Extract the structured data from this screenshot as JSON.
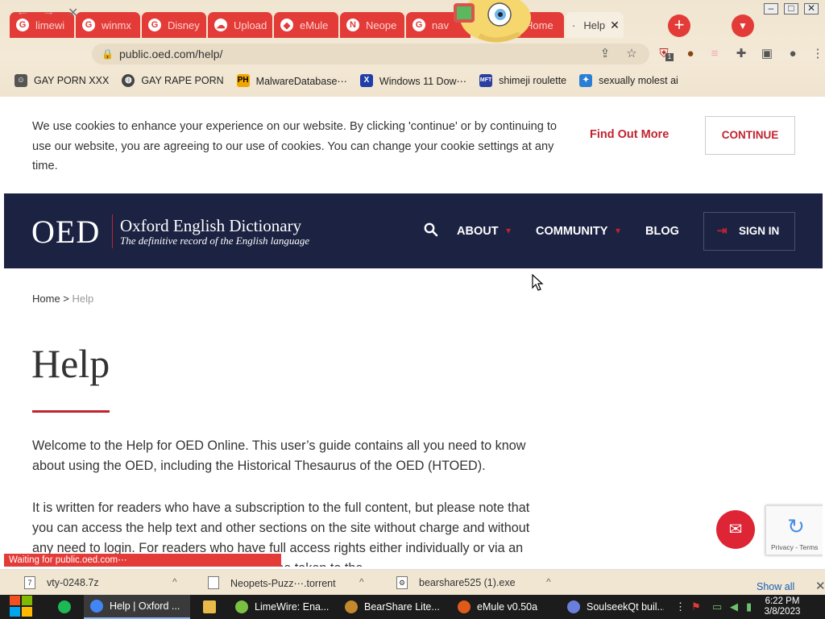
{
  "browser": {
    "tabs": [
      {
        "label": "limewi",
        "favicon": "G"
      },
      {
        "label": "winmx",
        "favicon": "G"
      },
      {
        "label": "Disney",
        "favicon": "G"
      },
      {
        "label": "Upload",
        "favicon": "☁"
      },
      {
        "label": "eMule",
        "favicon": "◆"
      },
      {
        "label": "Neope",
        "favicon": "N"
      },
      {
        "label": "nav",
        "favicon": "G"
      },
      {
        "label": "Home",
        "favicon": "O"
      },
      {
        "label": "Help",
        "favicon": "·"
      }
    ],
    "url": "public.oed.com/help/",
    "bookmarks": [
      {
        "label": "GAY PORN XXX"
      },
      {
        "label": "GAY RAPE PORN"
      },
      {
        "label": "MalwareDatabase⋯"
      },
      {
        "label": "Windows 11 Dow⋯"
      },
      {
        "label": "shimeji roulette"
      },
      {
        "label": "sexually molest ai"
      }
    ],
    "status_text": "Waiting for public.oed.com⋯",
    "extension_badge": "1"
  },
  "cookie_banner": {
    "text": "We use cookies to enhance your experience on our website. By clicking 'continue' or by continuing to use our website, you are agreeing to our use of cookies. You can change your cookie settings at any time.",
    "find_out_more": "Find Out More",
    "continue": "CONTINUE"
  },
  "header": {
    "logo": "OED",
    "name": "Oxford English Dictionary",
    "tagline": "The definitive record of the English language",
    "nav": {
      "about": "ABOUT",
      "community": "COMMUNITY",
      "blog": "BLOG"
    },
    "sign_in": "SIGN IN"
  },
  "breadcrumb": {
    "home": "Home",
    "separator": " > ",
    "current": "Help"
  },
  "main": {
    "title": "Help",
    "para1": "Welcome to the Help for OED Online. This user’s guide contains all you need to know about using the OED, including the Historical Thesaurus of the OED (HTOED).",
    "para2": "It is written for readers who have a subscription to the full content, but please note that you can access the help text and other sections on the site without charge and without any need to login. For readers who have full access rights either individually or via an institution, once you are logged in you will be taken to the"
  },
  "recaptcha": {
    "text": "Privacy - Terms"
  },
  "downloads": {
    "items": [
      {
        "name": "vty-0248.7z"
      },
      {
        "name": "Neopets-Puzz⋯.torrent"
      },
      {
        "name": "bearshare525 (1).exe"
      }
    ],
    "show_all": "Show all"
  },
  "taskbar": {
    "items": [
      {
        "label": "Help | Oxford ...",
        "color": "#4285f4"
      },
      {
        "label": "",
        "color": "#e9b949"
      },
      {
        "label": "LimeWire: Ena...",
        "color": "#7ac143"
      },
      {
        "label": "BearShare Lite...",
        "color": "#c4892c"
      },
      {
        "label": "eMule v0.50a",
        "color": "#e05a1c"
      },
      {
        "label": "SoulseekQt buil...",
        "color": "#6a7fdb"
      }
    ],
    "time": "6:22 PM",
    "date": "3/8/2023"
  }
}
